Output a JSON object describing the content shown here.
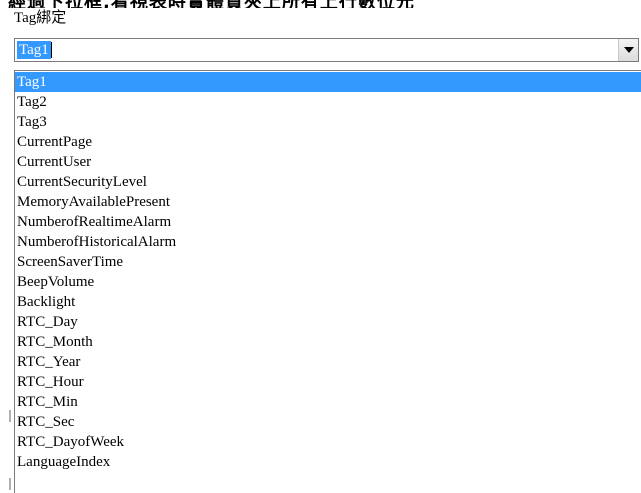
{
  "top_clipped_text": "經過下拉框,看視表時實體資夾上所有上行數位元",
  "field_label": "Tag綁定",
  "combo": {
    "value": "Tag1",
    "button_icon": "chevron-down-icon"
  },
  "dropdown": {
    "selected_index": 0,
    "items": [
      "Tag1",
      "Tag2",
      "Tag3",
      "CurrentPage",
      "CurrentUser",
      "CurrentSecurityLevel",
      "MemoryAvailablePresent",
      "NumberofRealtimeAlarm",
      "NumberofHistoricalAlarm",
      "ScreenSaverTime",
      "BeepVolume",
      "Backlight",
      "RTC_Day",
      "RTC_Month",
      "RTC_Year",
      "RTC_Hour",
      "RTC_Min",
      "RTC_Sec",
      "RTC_DayofWeek",
      "LanguageIndex"
    ]
  },
  "colors": {
    "selection": "#3399ff",
    "selection_text": "#ffffff",
    "border": "#7a7a7a"
  }
}
